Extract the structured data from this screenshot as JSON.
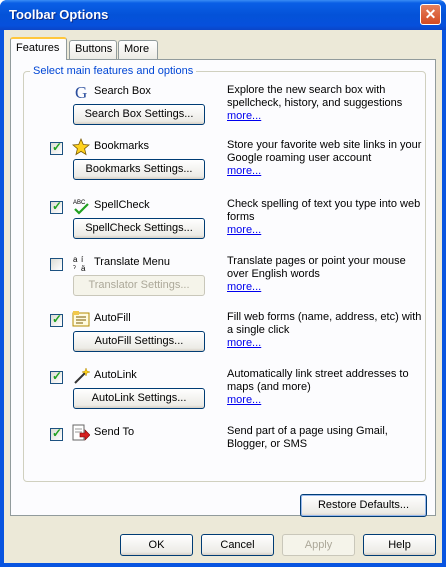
{
  "window": {
    "title": "Toolbar Options",
    "close_glyph": "✕"
  },
  "tabs": [
    {
      "label": "Features",
      "active": true
    },
    {
      "label": "Buttons",
      "active": false
    },
    {
      "label": "More",
      "active": false
    }
  ],
  "group": {
    "legend": "Select main features and options"
  },
  "features": [
    {
      "label": "Search Box",
      "checkbox": false,
      "checked": false,
      "icon": "google-g-icon",
      "button": "Search Box Settings...",
      "button_enabled": true,
      "desc": "Explore the new search box with spellcheck, history, and suggestions",
      "more": "more..."
    },
    {
      "label": "Bookmarks",
      "checkbox": true,
      "checked": true,
      "icon": "star-icon",
      "button": "Bookmarks Settings...",
      "button_enabled": true,
      "desc": "Store your favorite web site links in your Google roaming user account",
      "more": "more..."
    },
    {
      "label": "SpellCheck",
      "checkbox": true,
      "checked": true,
      "icon": "spellcheck-icon",
      "button": "SpellCheck Settings...",
      "button_enabled": true,
      "desc": "Check spelling of text you type into web forms",
      "more": "more..."
    },
    {
      "label": "Translate Menu",
      "checkbox": true,
      "checked": false,
      "icon": "translate-icon",
      "button": "Translator Settings...",
      "button_enabled": false,
      "desc": "Translate pages or point your mouse over English words",
      "more": "more..."
    },
    {
      "label": "AutoFill",
      "checkbox": true,
      "checked": true,
      "icon": "autofill-icon",
      "button": "AutoFill Settings...",
      "button_enabled": true,
      "desc": "Fill web forms (name, address, etc) with a single click",
      "more": "more..."
    },
    {
      "label": "AutoLink",
      "checkbox": true,
      "checked": true,
      "icon": "autolink-wand-icon",
      "button": "AutoLink Settings...",
      "button_enabled": true,
      "desc": "Automatically link street addresses to maps (and more)",
      "more": "more..."
    },
    {
      "label": "Send To",
      "checkbox": true,
      "checked": true,
      "icon": "send-to-icon",
      "button": null,
      "button_enabled": false,
      "desc": "Send part of a page using Gmail, Blogger, or SMS",
      "more": null
    }
  ],
  "restore_defaults": "Restore Defaults...",
  "dialog_buttons": {
    "ok": "OK",
    "cancel": "Cancel",
    "apply": "Apply",
    "help": "Help"
  },
  "colors": {
    "title_bar": "#0452d8",
    "legend_text": "#0046d5",
    "check_mark": "#21a121",
    "link": "#0000ee"
  }
}
